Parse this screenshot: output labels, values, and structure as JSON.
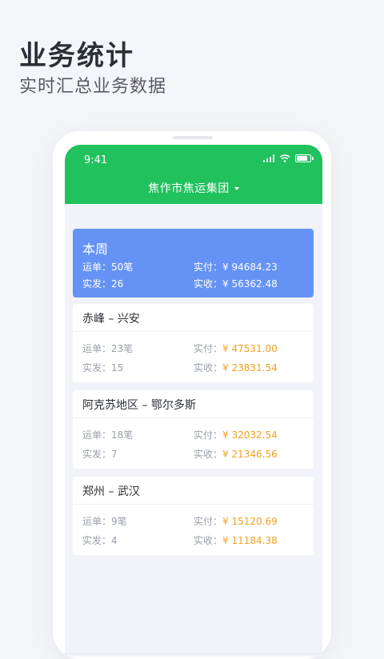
{
  "promo": {
    "title": "业务统计",
    "subtitle": "实时汇总业务数据"
  },
  "status_bar": {
    "time": "9:41"
  },
  "header": {
    "company": "焦作市焦运集团"
  },
  "summary": {
    "title": "本周",
    "waybill_label": "运单：",
    "waybill_value": "50笔",
    "paid_label": "实付：",
    "paid_value": "¥ 94684.23",
    "shipped_label": "实发：",
    "shipped_value": "26",
    "received_label": "实收：",
    "received_value": "¥ 56362.48"
  },
  "routes": [
    {
      "title": "赤峰  –  兴安",
      "waybill_label": "运单：",
      "waybill_value": "23笔",
      "paid_label": "实付：",
      "paid_value": "¥ 47531.00",
      "shipped_label": "实发：",
      "shipped_value": "15",
      "received_label": "实收：",
      "received_value": "¥ 23831.54"
    },
    {
      "title": "阿克苏地区 – 鄂尔多斯",
      "waybill_label": "运单：",
      "waybill_value": "18笔",
      "paid_label": "实付：",
      "paid_value": "¥ 32032.54",
      "shipped_label": "实发：",
      "shipped_value": "7",
      "received_label": "实收：",
      "received_value": "¥ 21346.56"
    },
    {
      "title": "郑州 – 武汉",
      "waybill_label": "运单：",
      "waybill_value": "9笔",
      "paid_label": "实付：",
      "paid_value": "¥ 15120.69",
      "shipped_label": "实发：",
      "shipped_value": "4",
      "received_label": "实收：",
      "received_value": "¥ 11184.38"
    }
  ],
  "colors": {
    "header_green": "#21c15e",
    "summary_blue": "#6593f5",
    "amount_orange": "#f3a01f"
  }
}
